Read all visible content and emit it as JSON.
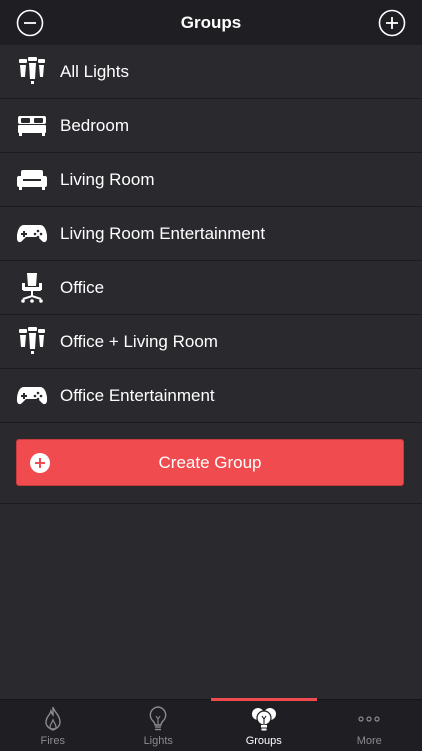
{
  "header": {
    "title": "Groups"
  },
  "groups": [
    {
      "label": "All Lights",
      "icon": "bulbs-icon"
    },
    {
      "label": "Bedroom",
      "icon": "bed-icon"
    },
    {
      "label": "Living Room",
      "icon": "sofa-icon"
    },
    {
      "label": "Living Room Entertainment",
      "icon": "gamepad-icon"
    },
    {
      "label": "Office",
      "icon": "office-chair-icon"
    },
    {
      "label": "Office + Living Room",
      "icon": "bulbs-icon"
    },
    {
      "label": "Office Entertainment",
      "icon": "gamepad-icon"
    }
  ],
  "create_button": {
    "label": "Create Group"
  },
  "tabs": [
    {
      "label": "Fires",
      "icon": "flame-icon"
    },
    {
      "label": "Lights",
      "icon": "bulb-icon"
    },
    {
      "label": "Groups",
      "icon": "bulb-cluster-icon",
      "active": true
    },
    {
      "label": "More",
      "icon": "more-dots-icon"
    }
  ],
  "colors": {
    "accent": "#f04b4f",
    "background": "#2a292e",
    "bar": "#1f1e23"
  }
}
